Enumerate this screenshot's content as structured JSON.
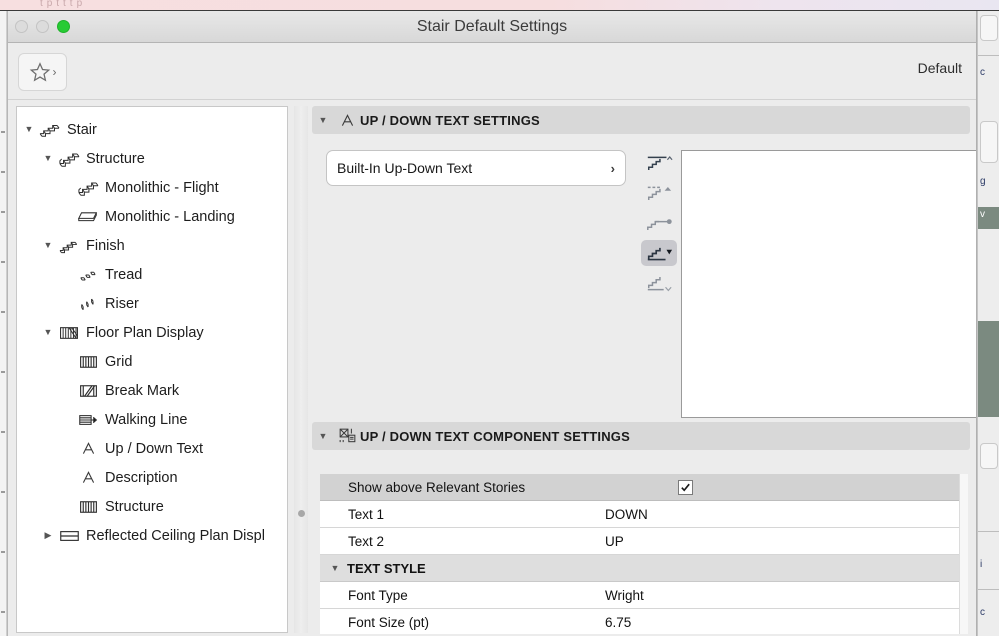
{
  "background": {
    "top_strip_ghost_text": "   t p       t            t            t           p",
    "right_panel_fragments": [
      "c",
      "g",
      "v",
      "i",
      "c"
    ]
  },
  "window": {
    "title": "Stair Default Settings",
    "traffic_lights": [
      "close-button",
      "minimize-button",
      "zoom-button"
    ],
    "colors": {
      "zoom_green": "#27cb34",
      "selection_grey": "#c8c8cd",
      "header_grey": "#d8d8d8"
    }
  },
  "toolbar": {
    "favorites_icon": "star-icon",
    "favorites_chevron": "›",
    "default_label": "Default"
  },
  "sidebar": {
    "items": [
      {
        "label": "Stair",
        "icon": "stair-icon",
        "depth": 0,
        "twisty": "▼"
      },
      {
        "label": "Structure",
        "icon": "stair-structure-icon",
        "depth": 1,
        "twisty": "▼"
      },
      {
        "label": "Monolithic - Flight",
        "icon": "monolithic-flight-icon",
        "depth": 2,
        "twisty": ""
      },
      {
        "label": "Monolithic - Landing",
        "icon": "monolithic-landing-icon",
        "depth": 2,
        "twisty": ""
      },
      {
        "label": "Finish",
        "icon": "finish-icon",
        "depth": 1,
        "twisty": "▼"
      },
      {
        "label": "Tread",
        "icon": "tread-icon",
        "depth": 2,
        "twisty": ""
      },
      {
        "label": "Riser",
        "icon": "riser-icon",
        "depth": 2,
        "twisty": ""
      },
      {
        "label": "Floor Plan Display",
        "icon": "floor-plan-display-icon",
        "depth": 1,
        "twisty": "▼"
      },
      {
        "label": "Grid",
        "icon": "grid-icon",
        "depth": 2,
        "twisty": ""
      },
      {
        "label": "Break Mark",
        "icon": "break-mark-icon",
        "depth": 2,
        "twisty": ""
      },
      {
        "label": "Walking Line",
        "icon": "walking-line-icon",
        "depth": 2,
        "twisty": ""
      },
      {
        "label": "Up / Down Text",
        "icon": "text-a-icon",
        "depth": 2,
        "twisty": ""
      },
      {
        "label": "Description",
        "icon": "text-a-icon",
        "depth": 2,
        "twisty": ""
      },
      {
        "label": "Structure",
        "icon": "grid-icon",
        "depth": 2,
        "twisty": ""
      },
      {
        "label": "Reflected Ceiling Plan Displ",
        "icon": "reflected-ceiling-icon",
        "depth": 1,
        "twisty": "▶"
      }
    ]
  },
  "main": {
    "section1": {
      "title": "UP / DOWN TEXT SETTINGS",
      "icon": "text-a-icon",
      "twisty": "▼",
      "combo_value": "Built-In Up-Down Text",
      "combo_chevron": "›",
      "icon_options": [
        {
          "name": "up-down-text-option-1",
          "selected": false
        },
        {
          "name": "up-down-text-option-2",
          "selected": false
        },
        {
          "name": "up-down-text-option-3",
          "selected": false
        },
        {
          "name": "up-down-text-option-4",
          "selected": true
        },
        {
          "name": "up-down-text-option-5",
          "selected": false
        }
      ]
    },
    "section2": {
      "title": "UP / DOWN TEXT COMPONENT SETTINGS",
      "icon": "component-settings-icon",
      "twisty": "▼",
      "rows": [
        {
          "type": "header",
          "label": "Show above Relevant Stories",
          "checked": true
        },
        {
          "type": "value",
          "label": "Text 1",
          "value": "DOWN"
        },
        {
          "type": "value",
          "label": "Text 2",
          "value": "UP"
        },
        {
          "type": "group",
          "label": "TEXT STYLE",
          "twisty": "▼"
        },
        {
          "type": "value",
          "label": "Font Type",
          "value": "Wright"
        },
        {
          "type": "value",
          "label": "Font Size (pt)",
          "value": "6.75"
        }
      ]
    }
  }
}
